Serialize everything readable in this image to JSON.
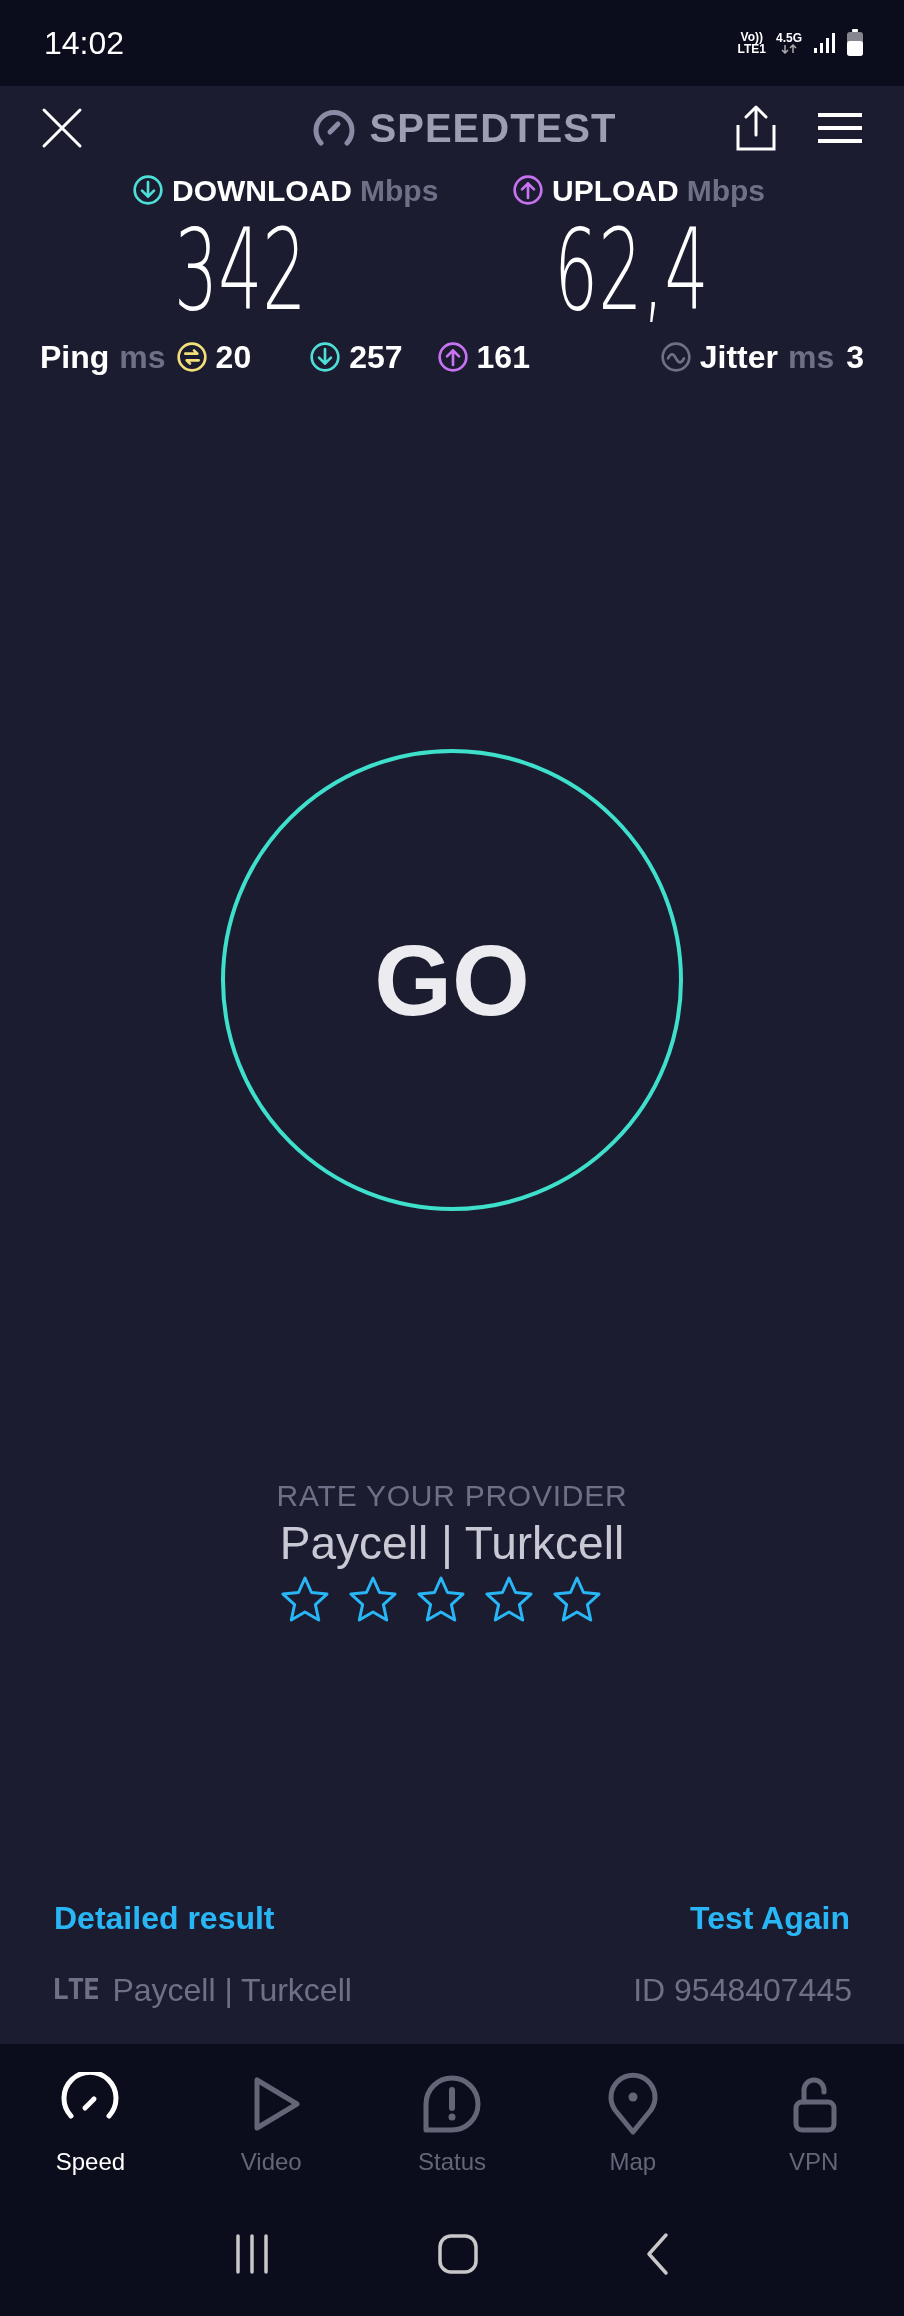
{
  "status_bar": {
    "time": "14:02",
    "volte": "Vo))",
    "lte_slot": "LTE1",
    "network": "4.5G"
  },
  "header": {
    "title": "SPEEDTEST"
  },
  "results": [
    {
      "kind": "download",
      "label": "DOWNLOAD",
      "unit": "Mbps",
      "value": "342"
    },
    {
      "kind": "upload",
      "label": "UPLOAD",
      "unit": "Mbps",
      "value": "62,4"
    }
  ],
  "ping": {
    "label": "Ping",
    "unit": "ms",
    "idle": "20",
    "download": "257",
    "upload": "161"
  },
  "jitter": {
    "label": "Jitter",
    "unit": "ms",
    "value": "3"
  },
  "go_button": "GO",
  "rating": {
    "title": "RATE YOUR PROVIDER",
    "provider": "Paycell | Turkcell",
    "stars": 0
  },
  "links": [
    "Detailed result",
    "Test Again"
  ],
  "connection": {
    "type": "LTE",
    "provider": "Paycell | Turkcell",
    "id": "ID 9548407445"
  },
  "nav": [
    {
      "kind": "speed",
      "label": "Speed",
      "selected": true
    },
    {
      "kind": "video",
      "label": "Video",
      "selected": false
    },
    {
      "kind": "status",
      "label": "Status",
      "selected": false
    },
    {
      "kind": "map",
      "label": "Map",
      "selected": false
    },
    {
      "kind": "vpn",
      "label": "VPN",
      "selected": false
    }
  ]
}
